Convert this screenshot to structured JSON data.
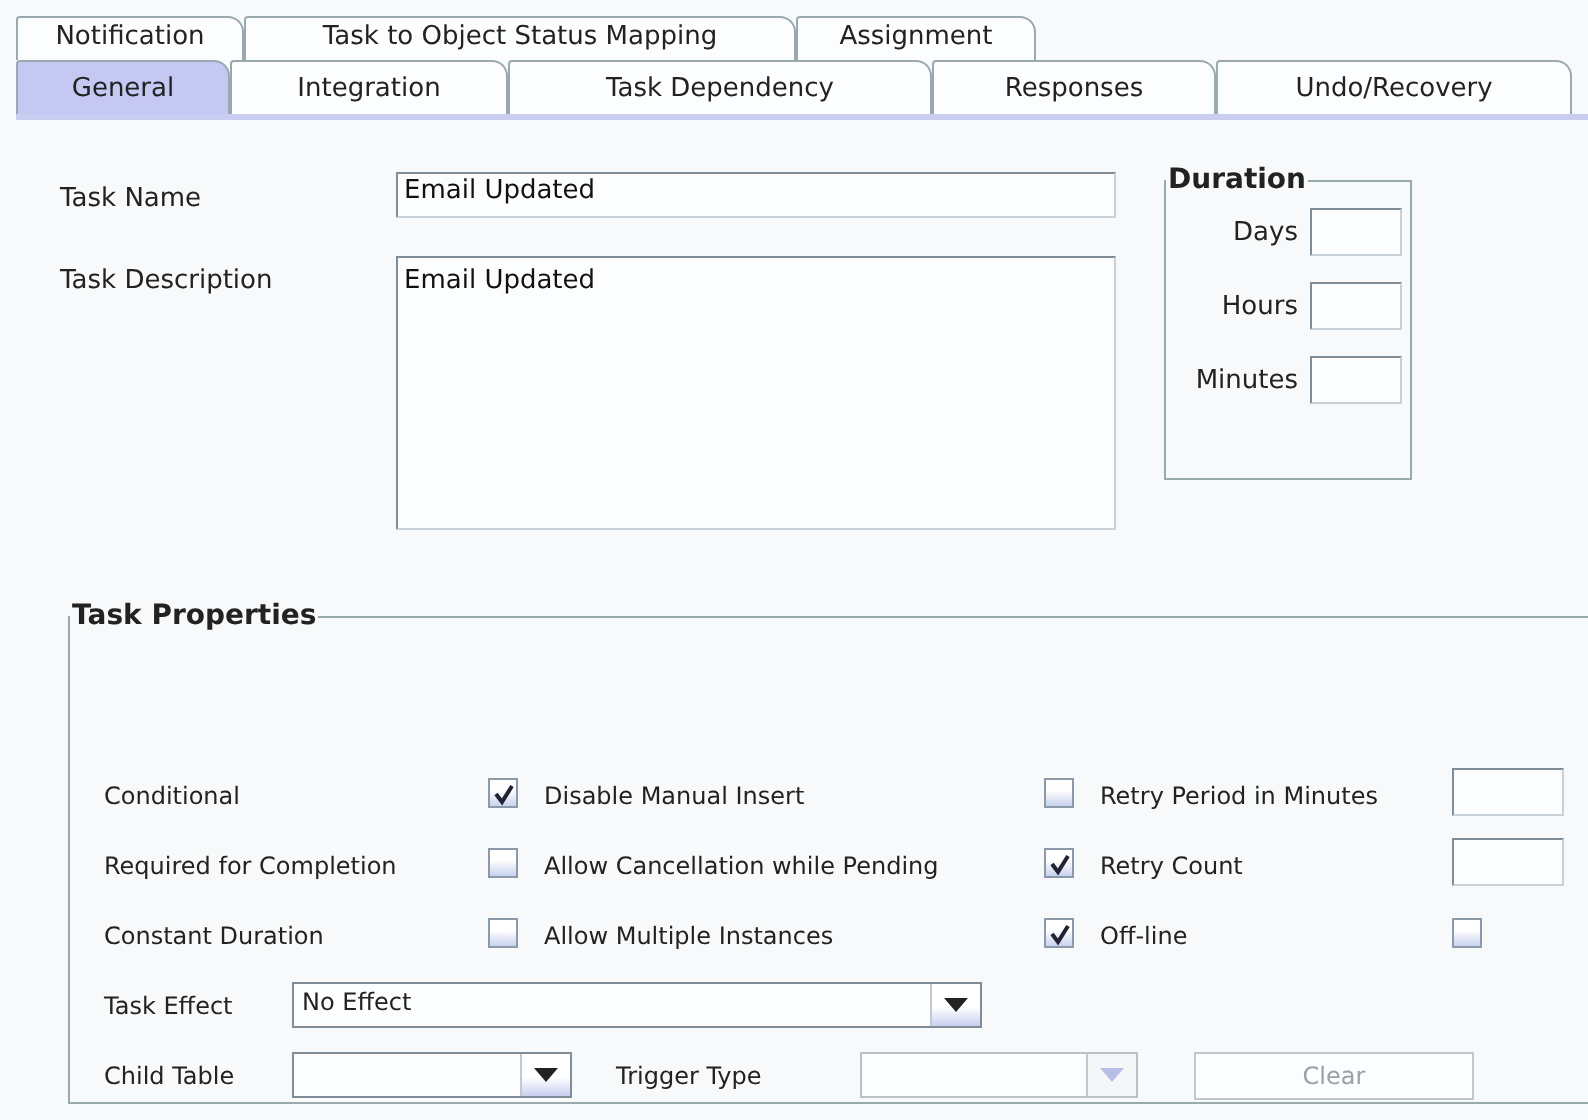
{
  "tabs_row_1": [
    {
      "label": "Notification",
      "selected": false
    },
    {
      "label": "Task to Object Status Mapping",
      "selected": false
    },
    {
      "label": "Assignment",
      "selected": false
    }
  ],
  "tabs_row_2": [
    {
      "label": "General",
      "selected": true
    },
    {
      "label": "Integration",
      "selected": false
    },
    {
      "label": "Task Dependency",
      "selected": false
    },
    {
      "label": "Responses",
      "selected": false
    },
    {
      "label": "Undo/Recovery",
      "selected": false
    }
  ],
  "task_name": {
    "label": "Task Name",
    "value": "Email Updated"
  },
  "task_description": {
    "label": "Task Description",
    "value": "Email Updated"
  },
  "duration": {
    "title": "Duration",
    "fields": [
      {
        "label": "Days"
      },
      {
        "label": "Hours"
      },
      {
        "label": "Minutes"
      }
    ]
  },
  "task_properties": {
    "title": "Task Properties",
    "options": [
      {
        "kind": "checkbox",
        "label": "Conditional",
        "checked": true
      },
      {
        "kind": "checkbox",
        "label": "Disable Manual Insert",
        "checked": false
      },
      {
        "kind": "field",
        "label": "Retry Period in Minutes"
      },
      {
        "kind": "checkbox",
        "label": "Required for Completion",
        "checked": false
      },
      {
        "kind": "checkbox",
        "label": "Allow Cancellation while Pending",
        "checked": true
      },
      {
        "kind": "field",
        "label": "Retry Count"
      },
      {
        "kind": "checkbox",
        "label": "Constant Duration",
        "checked": false
      },
      {
        "kind": "checkbox",
        "label": "Allow Multiple Instances",
        "checked": true
      },
      {
        "kind": "checkbox",
        "label": "Off-line",
        "checked": false
      }
    ],
    "task_effect": {
      "label": "Task Effect",
      "value": "No Effect"
    },
    "child_table": {
      "label": "Child Table",
      "disabled": false
    },
    "trigger_type": {
      "label": "Trigger Type",
      "disabled": true
    },
    "clear_button": {
      "label": "Clear",
      "disabled": true
    }
  }
}
